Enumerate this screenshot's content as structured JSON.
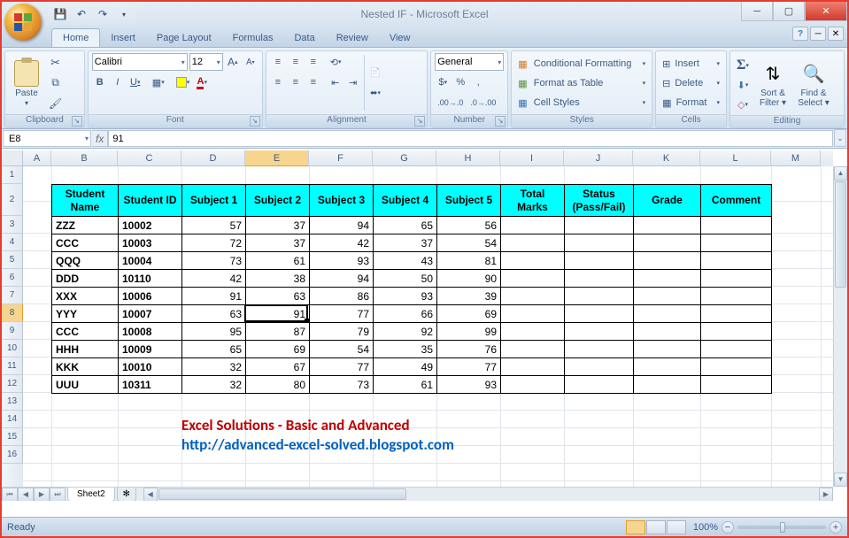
{
  "title": "Nested IF - Microsoft Excel",
  "qat": {
    "save": "💾",
    "undo": "↶",
    "redo": "↷"
  },
  "tabs": [
    "Home",
    "Insert",
    "Page Layout",
    "Formulas",
    "Data",
    "Review",
    "View"
  ],
  "active_tab": 0,
  "ribbon": {
    "clipboard": {
      "label": "Clipboard",
      "paste": "Paste",
      "cut": "Cut",
      "copy": "Copy",
      "brush": "Format Painter"
    },
    "font": {
      "label": "Font",
      "name": "Calibri",
      "size": "12",
      "bold": "B",
      "italic": "I",
      "underline": "U"
    },
    "alignment": {
      "label": "Alignment",
      "wrap": "Wrap Text",
      "merge": "Merge & Center"
    },
    "number": {
      "label": "Number",
      "format": "General"
    },
    "styles": {
      "label": "Styles",
      "cf": "Conditional Formatting",
      "fat": "Format as Table",
      "cs": "Cell Styles"
    },
    "cells": {
      "label": "Cells",
      "ins": "Insert",
      "del": "Delete",
      "fmt": "Format"
    },
    "editing": {
      "label": "Editing",
      "sort": "Sort & Filter",
      "find": "Find & Select"
    }
  },
  "namebox": "E8",
  "formula": "91",
  "columns": [
    {
      "l": "A",
      "w": 32
    },
    {
      "l": "B",
      "w": 75
    },
    {
      "l": "C",
      "w": 72
    },
    {
      "l": "D",
      "w": 72
    },
    {
      "l": "E",
      "w": 72
    },
    {
      "l": "F",
      "w": 72
    },
    {
      "l": "G",
      "w": 72
    },
    {
      "l": "H",
      "w": 72
    },
    {
      "l": "I",
      "w": 72
    },
    {
      "l": "J",
      "w": 78
    },
    {
      "l": "K",
      "w": 76
    },
    {
      "l": "L",
      "w": 80
    },
    {
      "l": "M",
      "w": 56
    }
  ],
  "sel_col_idx": 4,
  "sel_row": 8,
  "rows_vis": 16,
  "table": {
    "headers": [
      "Student Name",
      "Student ID",
      "Subject 1",
      "Subject 2",
      "Subject 3",
      "Subject 4",
      "Subject 5",
      "Total Marks",
      "Status (Pass/Fail)",
      "Grade",
      "Comment"
    ],
    "rows": [
      [
        "ZZZ",
        "10002",
        57,
        37,
        94,
        65,
        56,
        "",
        "",
        "",
        ""
      ],
      [
        "CCC",
        "10003",
        72,
        37,
        42,
        37,
        54,
        "",
        "",
        "",
        ""
      ],
      [
        "QQQ",
        "10004",
        73,
        61,
        93,
        43,
        81,
        "",
        "",
        "",
        ""
      ],
      [
        "DDD",
        "10110",
        42,
        38,
        94,
        50,
        90,
        "",
        "",
        "",
        ""
      ],
      [
        "XXX",
        "10006",
        91,
        63,
        86,
        93,
        39,
        "",
        "",
        "",
        ""
      ],
      [
        "YYY",
        "10007",
        63,
        91,
        77,
        66,
        69,
        "",
        "",
        "",
        ""
      ],
      [
        "CCC",
        "10008",
        95,
        87,
        79,
        92,
        99,
        "",
        "",
        "",
        ""
      ],
      [
        "HHH",
        "10009",
        65,
        69,
        54,
        35,
        76,
        "",
        "",
        "",
        ""
      ],
      [
        "KKK",
        "10010",
        32,
        67,
        77,
        49,
        77,
        "",
        "",
        "",
        ""
      ],
      [
        "UUU",
        "10311",
        32,
        80,
        73,
        61,
        93,
        "",
        "",
        "",
        ""
      ]
    ]
  },
  "freetext1": "Excel Solutions - Basic and Advanced",
  "freetext2": "http://advanced-excel-solved.blogspot.com",
  "sheet_tab": "Sheet2",
  "status_text": "Ready",
  "zoom": "100%",
  "chart_data": {
    "type": "table",
    "title": "Student marks",
    "columns": [
      "Student Name",
      "Student ID",
      "Subject 1",
      "Subject 2",
      "Subject 3",
      "Subject 4",
      "Subject 5",
      "Total Marks",
      "Status (Pass/Fail)",
      "Grade",
      "Comment"
    ],
    "rows": [
      [
        "ZZZ",
        10002,
        57,
        37,
        94,
        65,
        56,
        null,
        null,
        null,
        null
      ],
      [
        "CCC",
        10003,
        72,
        37,
        42,
        37,
        54,
        null,
        null,
        null,
        null
      ],
      [
        "QQQ",
        10004,
        73,
        61,
        93,
        43,
        81,
        null,
        null,
        null,
        null
      ],
      [
        "DDD",
        10110,
        42,
        38,
        94,
        50,
        90,
        null,
        null,
        null,
        null
      ],
      [
        "XXX",
        10006,
        91,
        63,
        86,
        93,
        39,
        null,
        null,
        null,
        null
      ],
      [
        "YYY",
        10007,
        63,
        91,
        77,
        66,
        69,
        null,
        null,
        null,
        null
      ],
      [
        "CCC",
        10008,
        95,
        87,
        79,
        92,
        99,
        null,
        null,
        null,
        null
      ],
      [
        "HHH",
        10009,
        65,
        69,
        54,
        35,
        76,
        null,
        null,
        null,
        null
      ],
      [
        "KKK",
        10010,
        32,
        67,
        77,
        49,
        77,
        null,
        null,
        null,
        null
      ],
      [
        "UUU",
        10311,
        32,
        80,
        73,
        61,
        93,
        null,
        null,
        null,
        null
      ]
    ]
  }
}
